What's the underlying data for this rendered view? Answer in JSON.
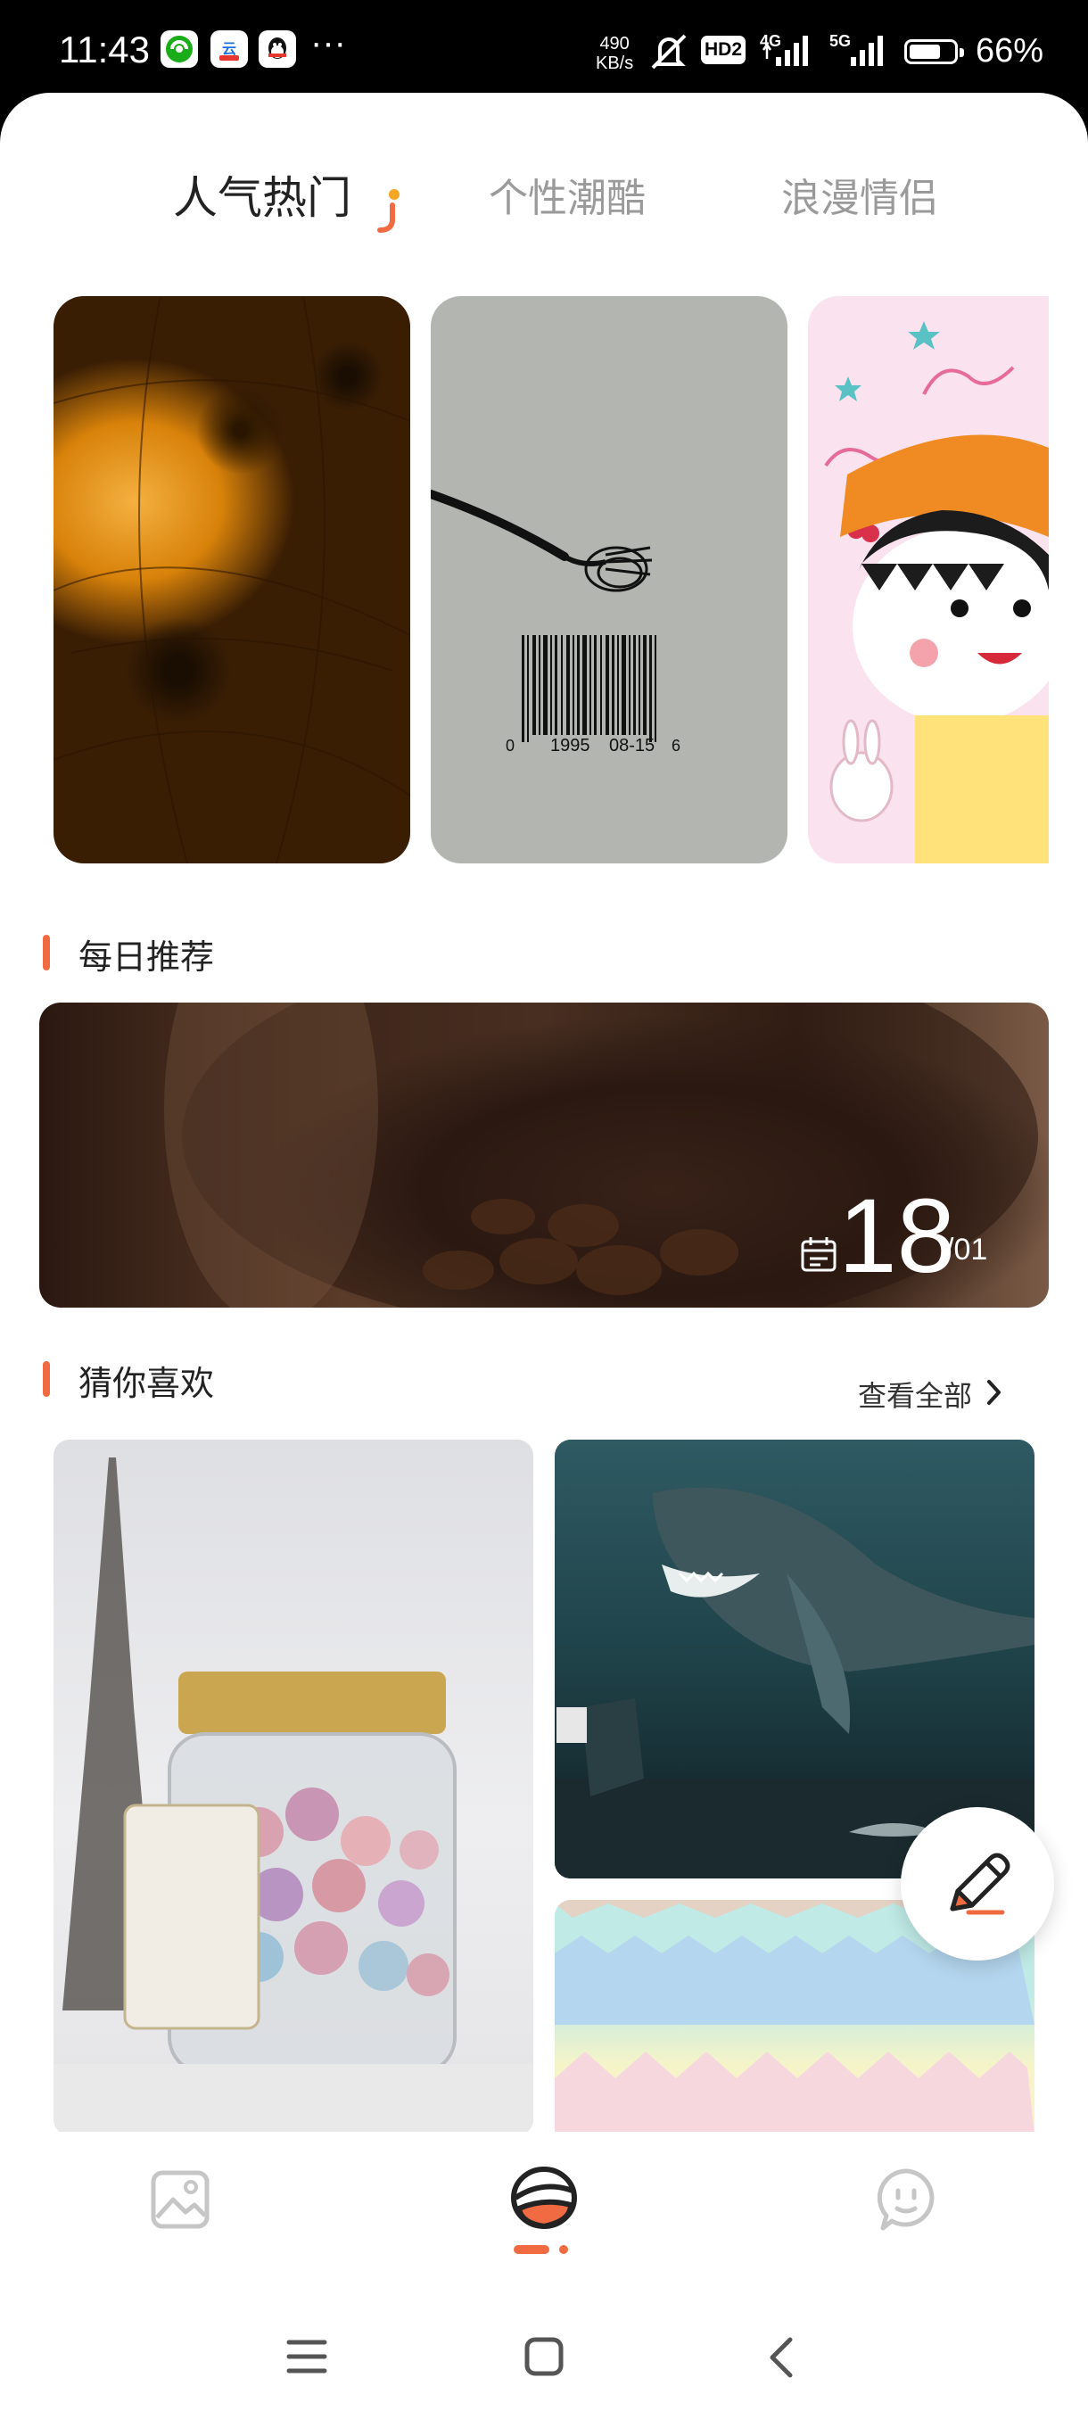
{
  "status_bar": {
    "time": "11:43",
    "apps": [
      "wechat-app-icon",
      "cloud-app-icon",
      "qq-app-icon"
    ],
    "more": "···",
    "net_speed_value": "490",
    "net_speed_unit": "KB/s",
    "hd_label": "HD2",
    "signal_1_label": "4G",
    "signal_2_label": "5G",
    "battery_level": 0.66,
    "battery_percent": "66%"
  },
  "tabs": [
    {
      "label": "人气热门",
      "active": true
    },
    {
      "label": "个性潮酷",
      "active": false
    },
    {
      "label": "浪漫情侣",
      "active": false
    }
  ],
  "barcode_numbers": [
    "0",
    "1995",
    "08-15",
    "6"
  ],
  "daily": {
    "title": "每日推荐",
    "day": "18",
    "month": "/01"
  },
  "guess": {
    "title": "猜你喜欢",
    "see_all": "查看全部"
  },
  "colors": {
    "accent": "#f06a42",
    "indicator_dot": "#f5a623"
  }
}
